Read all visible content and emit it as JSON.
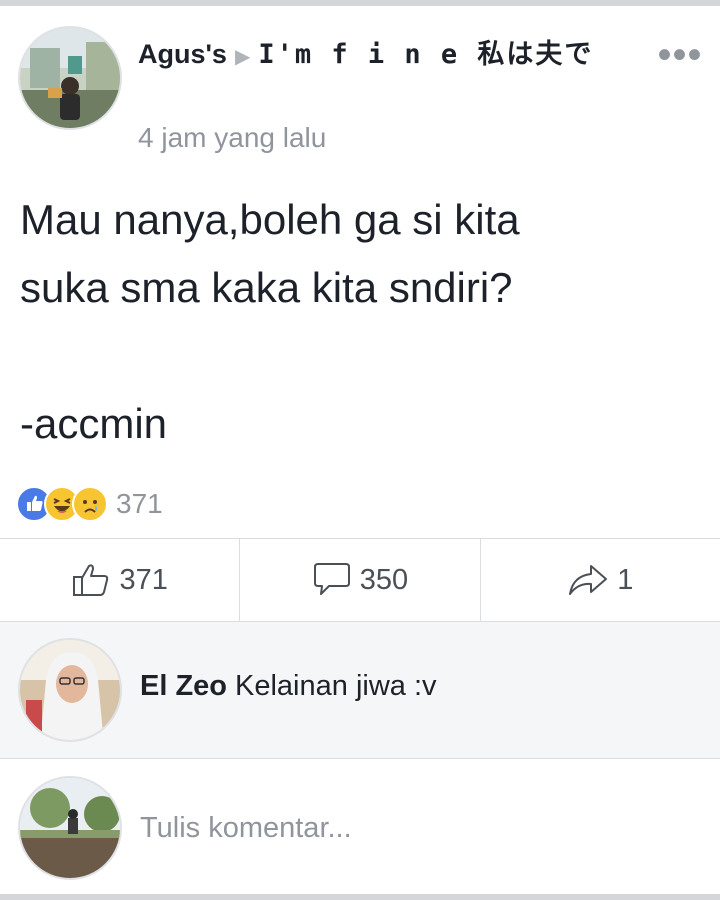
{
  "post": {
    "author": "Agus's",
    "group": "I'm f i n e 私は夫で",
    "timestamp": "4 jam yang lalu",
    "body": "Mau nanya,boleh ga si kita\nsuka sma kaka kita sndiri?\n\n-accmin",
    "more_icon": "more-horizontal-icon"
  },
  "reactions": {
    "icons": [
      "like-reaction-icon",
      "haha-reaction-icon",
      "sad-reaction-icon"
    ],
    "count": "371"
  },
  "actions": {
    "like_count": "371",
    "comment_count": "350",
    "share_count": "1"
  },
  "comment": {
    "author": "El Zeo",
    "text": "Kelainan jiwa :v"
  },
  "compose": {
    "placeholder": "Tulis komentar..."
  },
  "colors": {
    "text": "#1d2129",
    "secondary": "#90949c",
    "divider": "#dadde1",
    "like_blue": "#4a7ae6",
    "emoji_yellow": "#f7c531",
    "comment_bg": "#f5f6f7"
  }
}
